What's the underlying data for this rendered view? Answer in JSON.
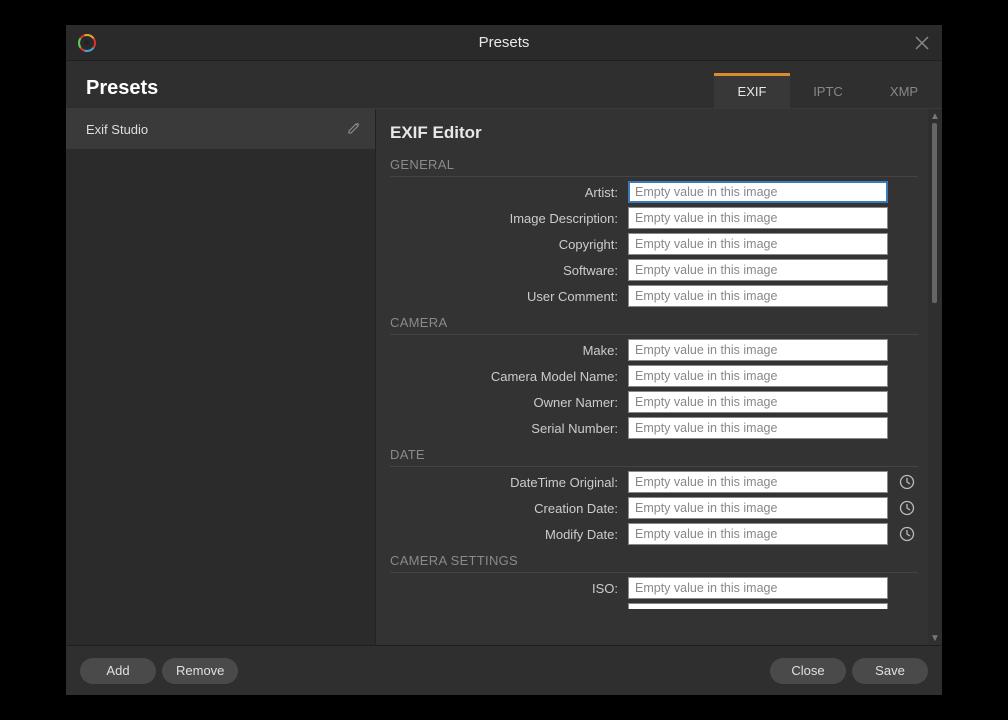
{
  "window": {
    "title": "Presets"
  },
  "header": {
    "heading": "Presets"
  },
  "tabs": {
    "exif": "EXIF",
    "iptc": "IPTC",
    "xmp": "XMP",
    "active": "exif"
  },
  "sidebar": {
    "items": [
      {
        "label": "Exif Studio"
      }
    ]
  },
  "editor": {
    "title": "EXIF Editor",
    "placeholder": "Empty value in this image",
    "sections": {
      "general": {
        "label": "GENERAL",
        "fields": {
          "artist": "Artist:",
          "image_description": "Image Description:",
          "copyright": "Copyright:",
          "software": "Software:",
          "user_comment": "User Comment:"
        }
      },
      "camera": {
        "label": "CAMERA",
        "fields": {
          "make": "Make:",
          "camera_model_name": "Camera Model Name:",
          "owner_namer": "Owner Namer:",
          "serial_number": "Serial Number:"
        }
      },
      "date": {
        "label": "DATE",
        "fields": {
          "datetime_original": "DateTime Original:",
          "creation_date": "Creation Date:",
          "modify_date": "Modify Date:"
        }
      },
      "camera_settings": {
        "label": "CAMERA SETTINGS",
        "fields": {
          "iso": "ISO:"
        }
      }
    }
  },
  "footer": {
    "add": "Add",
    "remove": "Remove",
    "close": "Close",
    "save": "Save"
  }
}
